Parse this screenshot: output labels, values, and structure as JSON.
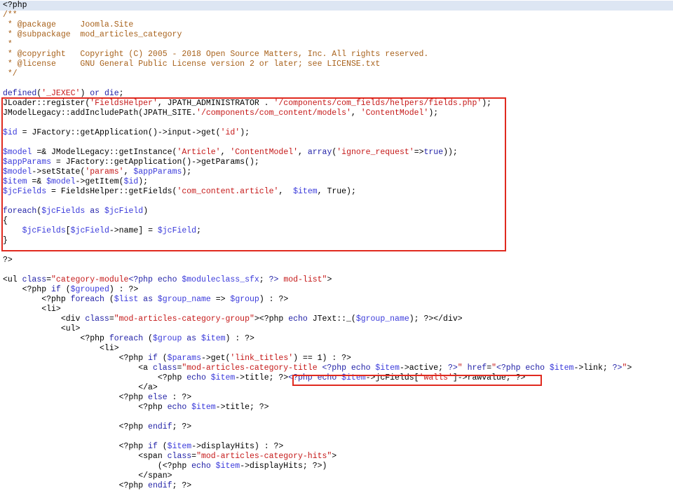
{
  "editor": {
    "colors": {
      "keyword": "#2323a8",
      "variable": "#3a3adb",
      "string": "#c51919",
      "comment": "#a8621c",
      "highlight_box": "#e02a1f",
      "first_line_bg": "#dde6f3"
    },
    "lines": [
      [
        {
          "t": "plain",
          "v": "<?php"
        }
      ],
      [
        {
          "t": "cm",
          "v": "/**"
        }
      ],
      [
        {
          "t": "cm",
          "v": " * @package     Joomla.Site"
        }
      ],
      [
        {
          "t": "cm",
          "v": " * @subpackage  mod_articles_category"
        }
      ],
      [
        {
          "t": "cm",
          "v": " *"
        }
      ],
      [
        {
          "t": "cm",
          "v": " * @copyright   Copyright (C) 2005 - 2018 Open Source Matters, Inc. All rights reserved."
        }
      ],
      [
        {
          "t": "cm",
          "v": " * @license     GNU General Public License version 2 or later; see LICENSE.txt"
        }
      ],
      [
        {
          "t": "cm",
          "v": " */"
        }
      ],
      [],
      [
        {
          "t": "kw",
          "v": "defined"
        },
        {
          "t": "plain",
          "v": "("
        },
        {
          "t": "str",
          "v": "'_JEXEC'"
        },
        {
          "t": "plain",
          "v": ") "
        },
        {
          "t": "kw",
          "v": "or die"
        },
        {
          "t": "plain",
          "v": ";"
        }
      ],
      [
        {
          "t": "plain",
          "v": "JLoader::register("
        },
        {
          "t": "str",
          "v": "'FieldsHelper'"
        },
        {
          "t": "plain",
          "v": ", JPATH_ADMINISTRATOR . "
        },
        {
          "t": "str",
          "v": "'/components/com_fields/helpers/fields.php'"
        },
        {
          "t": "plain",
          "v": ");"
        }
      ],
      [
        {
          "t": "plain",
          "v": "JModelLegacy::addIncludePath(JPATH_SITE."
        },
        {
          "t": "str",
          "v": "'/components/com_content/models'"
        },
        {
          "t": "plain",
          "v": ", "
        },
        {
          "t": "str",
          "v": "'ContentModel'"
        },
        {
          "t": "plain",
          "v": ");"
        }
      ],
      [],
      [
        {
          "t": "var",
          "v": "$id"
        },
        {
          "t": "plain",
          "v": " = JFactory::getApplication()->input->get("
        },
        {
          "t": "str",
          "v": "'id'"
        },
        {
          "t": "plain",
          "v": ");"
        }
      ],
      [],
      [
        {
          "t": "var",
          "v": "$model"
        },
        {
          "t": "plain",
          "v": " =& JModelLegacy::getInstance("
        },
        {
          "t": "str",
          "v": "'Article'"
        },
        {
          "t": "plain",
          "v": ", "
        },
        {
          "t": "str",
          "v": "'ContentModel'"
        },
        {
          "t": "plain",
          "v": ", "
        },
        {
          "t": "kw",
          "v": "array"
        },
        {
          "t": "plain",
          "v": "("
        },
        {
          "t": "str",
          "v": "'ignore_request'"
        },
        {
          "t": "plain",
          "v": "=>"
        },
        {
          "t": "kw",
          "v": "true"
        },
        {
          "t": "plain",
          "v": "));"
        }
      ],
      [
        {
          "t": "var",
          "v": "$appParams"
        },
        {
          "t": "plain",
          "v": " = JFactory::getApplication()->getParams();"
        }
      ],
      [
        {
          "t": "var",
          "v": "$model"
        },
        {
          "t": "plain",
          "v": "->setState("
        },
        {
          "t": "str",
          "v": "'params'"
        },
        {
          "t": "plain",
          "v": ", "
        },
        {
          "t": "var",
          "v": "$appParams"
        },
        {
          "t": "plain",
          "v": ");"
        }
      ],
      [
        {
          "t": "var",
          "v": "$item"
        },
        {
          "t": "plain",
          "v": " =& "
        },
        {
          "t": "var",
          "v": "$model"
        },
        {
          "t": "plain",
          "v": "->getItem("
        },
        {
          "t": "var",
          "v": "$id"
        },
        {
          "t": "plain",
          "v": ");"
        }
      ],
      [
        {
          "t": "var",
          "v": "$jcFields"
        },
        {
          "t": "plain",
          "v": " = FieldsHelper::getFields("
        },
        {
          "t": "str",
          "v": "'com_content.article'"
        },
        {
          "t": "plain",
          "v": ",  "
        },
        {
          "t": "var",
          "v": "$item"
        },
        {
          "t": "plain",
          "v": ", True);"
        }
      ],
      [],
      [
        {
          "t": "kw",
          "v": "foreach"
        },
        {
          "t": "plain",
          "v": "("
        },
        {
          "t": "var",
          "v": "$jcFields"
        },
        {
          "t": "plain",
          "v": " "
        },
        {
          "t": "kw",
          "v": "as"
        },
        {
          "t": "plain",
          "v": " "
        },
        {
          "t": "var",
          "v": "$jcField"
        },
        {
          "t": "plain",
          "v": ")"
        }
      ],
      [
        {
          "t": "plain",
          "v": "{"
        }
      ],
      [
        {
          "t": "plain",
          "v": "    "
        },
        {
          "t": "var",
          "v": "$jcFields"
        },
        {
          "t": "plain",
          "v": "["
        },
        {
          "t": "var",
          "v": "$jcField"
        },
        {
          "t": "plain",
          "v": "->name] = "
        },
        {
          "t": "var",
          "v": "$jcField"
        },
        {
          "t": "plain",
          "v": ";"
        }
      ],
      [
        {
          "t": "plain",
          "v": "}"
        }
      ],
      [],
      [
        {
          "t": "plain",
          "v": "?>"
        }
      ],
      [],
      [
        {
          "t": "plain",
          "v": "<ul "
        },
        {
          "t": "kw",
          "v": "class"
        },
        {
          "t": "plain",
          "v": "="
        },
        {
          "t": "str",
          "v": "\"category-module"
        },
        {
          "t": "kw",
          "v": "<?php echo"
        },
        {
          "t": "plain",
          "v": " "
        },
        {
          "t": "var",
          "v": "$moduleclass_sfx"
        },
        {
          "t": "plain",
          "v": "; "
        },
        {
          "t": "kw",
          "v": "?>"
        },
        {
          "t": "str",
          "v": " mod-list\""
        },
        {
          "t": "plain",
          "v": ">"
        }
      ],
      [
        {
          "t": "plain",
          "v": "    <?php "
        },
        {
          "t": "kw",
          "v": "if"
        },
        {
          "t": "plain",
          "v": " ("
        },
        {
          "t": "var",
          "v": "$grouped"
        },
        {
          "t": "plain",
          "v": ") : ?>"
        }
      ],
      [
        {
          "t": "plain",
          "v": "        <?php "
        },
        {
          "t": "kw",
          "v": "foreach"
        },
        {
          "t": "plain",
          "v": " ("
        },
        {
          "t": "var",
          "v": "$list"
        },
        {
          "t": "plain",
          "v": " "
        },
        {
          "t": "kw",
          "v": "as"
        },
        {
          "t": "plain",
          "v": " "
        },
        {
          "t": "var",
          "v": "$group_name"
        },
        {
          "t": "plain",
          "v": " => "
        },
        {
          "t": "var",
          "v": "$group"
        },
        {
          "t": "plain",
          "v": ") : ?>"
        }
      ],
      [
        {
          "t": "plain",
          "v": "        <li>"
        }
      ],
      [
        {
          "t": "plain",
          "v": "            <div "
        },
        {
          "t": "kw",
          "v": "class"
        },
        {
          "t": "plain",
          "v": "="
        },
        {
          "t": "str",
          "v": "\"mod-articles-category-group\""
        },
        {
          "t": "plain",
          "v": "><?php "
        },
        {
          "t": "kw",
          "v": "echo"
        },
        {
          "t": "plain",
          "v": " JText::_("
        },
        {
          "t": "var",
          "v": "$group_name"
        },
        {
          "t": "plain",
          "v": "); ?></div>"
        }
      ],
      [
        {
          "t": "plain",
          "v": "            <ul>"
        }
      ],
      [
        {
          "t": "plain",
          "v": "                <?php "
        },
        {
          "t": "kw",
          "v": "foreach"
        },
        {
          "t": "plain",
          "v": " ("
        },
        {
          "t": "var",
          "v": "$group"
        },
        {
          "t": "plain",
          "v": " "
        },
        {
          "t": "kw",
          "v": "as"
        },
        {
          "t": "plain",
          "v": " "
        },
        {
          "t": "var",
          "v": "$item"
        },
        {
          "t": "plain",
          "v": ") : ?>"
        }
      ],
      [
        {
          "t": "plain",
          "v": "                    <li>"
        }
      ],
      [
        {
          "t": "plain",
          "v": "                        <?php "
        },
        {
          "t": "kw",
          "v": "if"
        },
        {
          "t": "plain",
          "v": " ("
        },
        {
          "t": "var",
          "v": "$params"
        },
        {
          "t": "plain",
          "v": "->get("
        },
        {
          "t": "str",
          "v": "'link_titles'"
        },
        {
          "t": "plain",
          "v": ") == 1) : ?>"
        }
      ],
      [
        {
          "t": "plain",
          "v": "                            <a "
        },
        {
          "t": "kw",
          "v": "class"
        },
        {
          "t": "plain",
          "v": "="
        },
        {
          "t": "str",
          "v": "\"mod-articles-category-title "
        },
        {
          "t": "kw",
          "v": "<?php echo"
        },
        {
          "t": "plain",
          "v": " "
        },
        {
          "t": "var",
          "v": "$item"
        },
        {
          "t": "plain",
          "v": "->active; "
        },
        {
          "t": "kw",
          "v": "?>"
        },
        {
          "t": "str",
          "v": "\""
        },
        {
          "t": "plain",
          "v": " "
        },
        {
          "t": "kw",
          "v": "href"
        },
        {
          "t": "plain",
          "v": "="
        },
        {
          "t": "str",
          "v": "\""
        },
        {
          "t": "kw",
          "v": "<?php echo"
        },
        {
          "t": "plain",
          "v": " "
        },
        {
          "t": "var",
          "v": "$item"
        },
        {
          "t": "plain",
          "v": "->link; "
        },
        {
          "t": "kw",
          "v": "?>"
        },
        {
          "t": "str",
          "v": "\""
        },
        {
          "t": "plain",
          "v": ">"
        }
      ],
      [
        {
          "t": "plain",
          "v": "                                <?php "
        },
        {
          "t": "kw",
          "v": "echo"
        },
        {
          "t": "plain",
          "v": " "
        },
        {
          "t": "var",
          "v": "$item"
        },
        {
          "t": "plain",
          "v": "->title; ?>"
        },
        {
          "t": "kw",
          "v": "<?php echo"
        },
        {
          "t": "plain",
          "v": " "
        },
        {
          "t": "var",
          "v": "$item"
        },
        {
          "t": "plain",
          "v": "->jcFields["
        },
        {
          "t": "str",
          "v": "'walls'"
        },
        {
          "t": "plain",
          "v": "]->rawvalue; ?>"
        }
      ],
      [
        {
          "t": "plain",
          "v": "                            </a>"
        }
      ],
      [
        {
          "t": "plain",
          "v": "                        <?php "
        },
        {
          "t": "kw",
          "v": "else"
        },
        {
          "t": "plain",
          "v": " : ?>"
        }
      ],
      [
        {
          "t": "plain",
          "v": "                            <?php "
        },
        {
          "t": "kw",
          "v": "echo"
        },
        {
          "t": "plain",
          "v": " "
        },
        {
          "t": "var",
          "v": "$item"
        },
        {
          "t": "plain",
          "v": "->title; ?>"
        }
      ],
      [],
      [
        {
          "t": "plain",
          "v": "                        <?php "
        },
        {
          "t": "kw",
          "v": "endif"
        },
        {
          "t": "plain",
          "v": "; ?>"
        }
      ],
      [],
      [
        {
          "t": "plain",
          "v": "                        <?php "
        },
        {
          "t": "kw",
          "v": "if"
        },
        {
          "t": "plain",
          "v": " ("
        },
        {
          "t": "var",
          "v": "$item"
        },
        {
          "t": "plain",
          "v": "->displayHits) : ?>"
        }
      ],
      [
        {
          "t": "plain",
          "v": "                            <span "
        },
        {
          "t": "kw",
          "v": "class"
        },
        {
          "t": "plain",
          "v": "="
        },
        {
          "t": "str",
          "v": "\"mod-articles-category-hits\""
        },
        {
          "t": "plain",
          "v": ">"
        }
      ],
      [
        {
          "t": "plain",
          "v": "                                (<?php "
        },
        {
          "t": "kw",
          "v": "echo"
        },
        {
          "t": "plain",
          "v": " "
        },
        {
          "t": "var",
          "v": "$item"
        },
        {
          "t": "plain",
          "v": "->displayHits; ?>)"
        }
      ],
      [
        {
          "t": "plain",
          "v": "                            </span>"
        }
      ],
      [
        {
          "t": "plain",
          "v": "                        <?php "
        },
        {
          "t": "kw",
          "v": "endif"
        },
        {
          "t": "plain",
          "v": "; ?>"
        }
      ]
    ]
  }
}
